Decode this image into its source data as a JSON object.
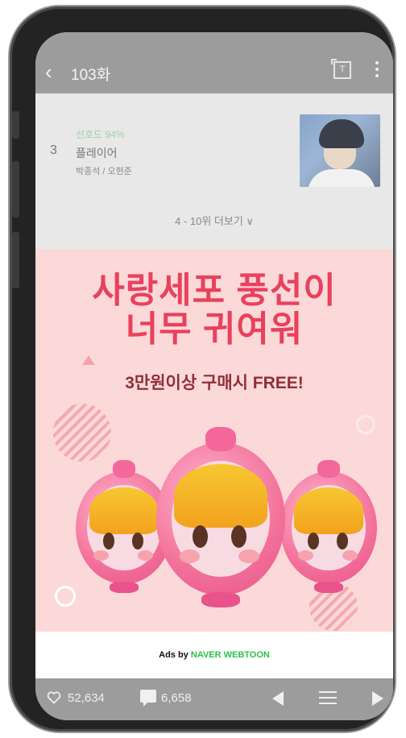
{
  "topbar": {
    "back_icon": "chevron-left-icon",
    "title": "103화",
    "text_toggle_icon": "text-size-icon",
    "text_toggle_glyph": "T",
    "more_icon": "more-vertical-icon"
  },
  "ranking": {
    "rank": "3",
    "preference": "선호도 94%",
    "title": "플레이어",
    "authors": "박종석 / 오현준",
    "more_label": "4 - 10위 더보기 ∨"
  },
  "ad": {
    "headline": "사랑세포 풍선이\n너무 귀여워",
    "subline": "3만원이상 구매시 FREE!",
    "ads_by_prefix": "Ads by",
    "ads_by_brand": "NAVER WEBTOON",
    "colors": {
      "headline": "#e9415d",
      "brand": "#29c24a",
      "background": "#fbd9d8"
    }
  },
  "bottombar": {
    "likes": "52,634",
    "comments": "6,658",
    "like_icon": "heart-icon",
    "comment_icon": "comment-icon",
    "prev_icon": "prev-episode-icon",
    "list_icon": "list-icon",
    "next_icon": "next-episode-icon"
  }
}
